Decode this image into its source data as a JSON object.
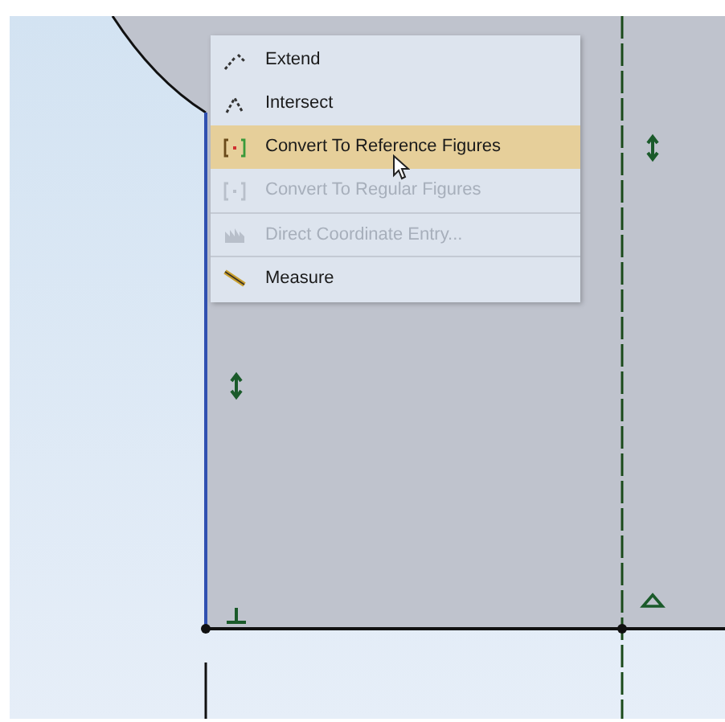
{
  "context_menu": {
    "items": [
      {
        "label": "Extend",
        "kind": "extend",
        "selected": false,
        "disabled": false,
        "separator_before": false
      },
      {
        "label": "Intersect",
        "kind": "intersect",
        "selected": false,
        "disabled": false,
        "separator_before": false
      },
      {
        "label": "Convert To Reference Figures",
        "kind": "bracket",
        "selected": true,
        "disabled": false,
        "separator_before": false
      },
      {
        "label": "Convert To Regular Figures",
        "kind": "bracket",
        "selected": false,
        "disabled": true,
        "separator_before": false
      },
      {
        "label": "Direct Coordinate Entry...",
        "kind": "chart",
        "selected": false,
        "disabled": true,
        "separator_before": true
      },
      {
        "label": "Measure",
        "kind": "ruler",
        "selected": false,
        "disabled": false,
        "separator_before": true
      }
    ]
  }
}
